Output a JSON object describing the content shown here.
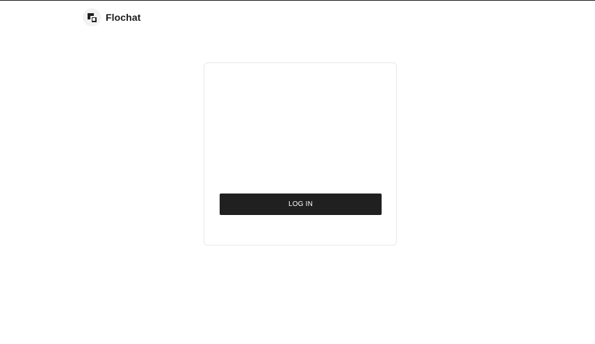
{
  "header": {
    "logo_icon": "flochat-logo-icon",
    "brand_name": "Flochat"
  },
  "login_card": {
    "login_button_label": "LOG IN"
  },
  "colors": {
    "button_background": "#202020",
    "button_text": "#ffffff",
    "card_border": "#e8e8e8",
    "page_background": "#ffffff"
  }
}
